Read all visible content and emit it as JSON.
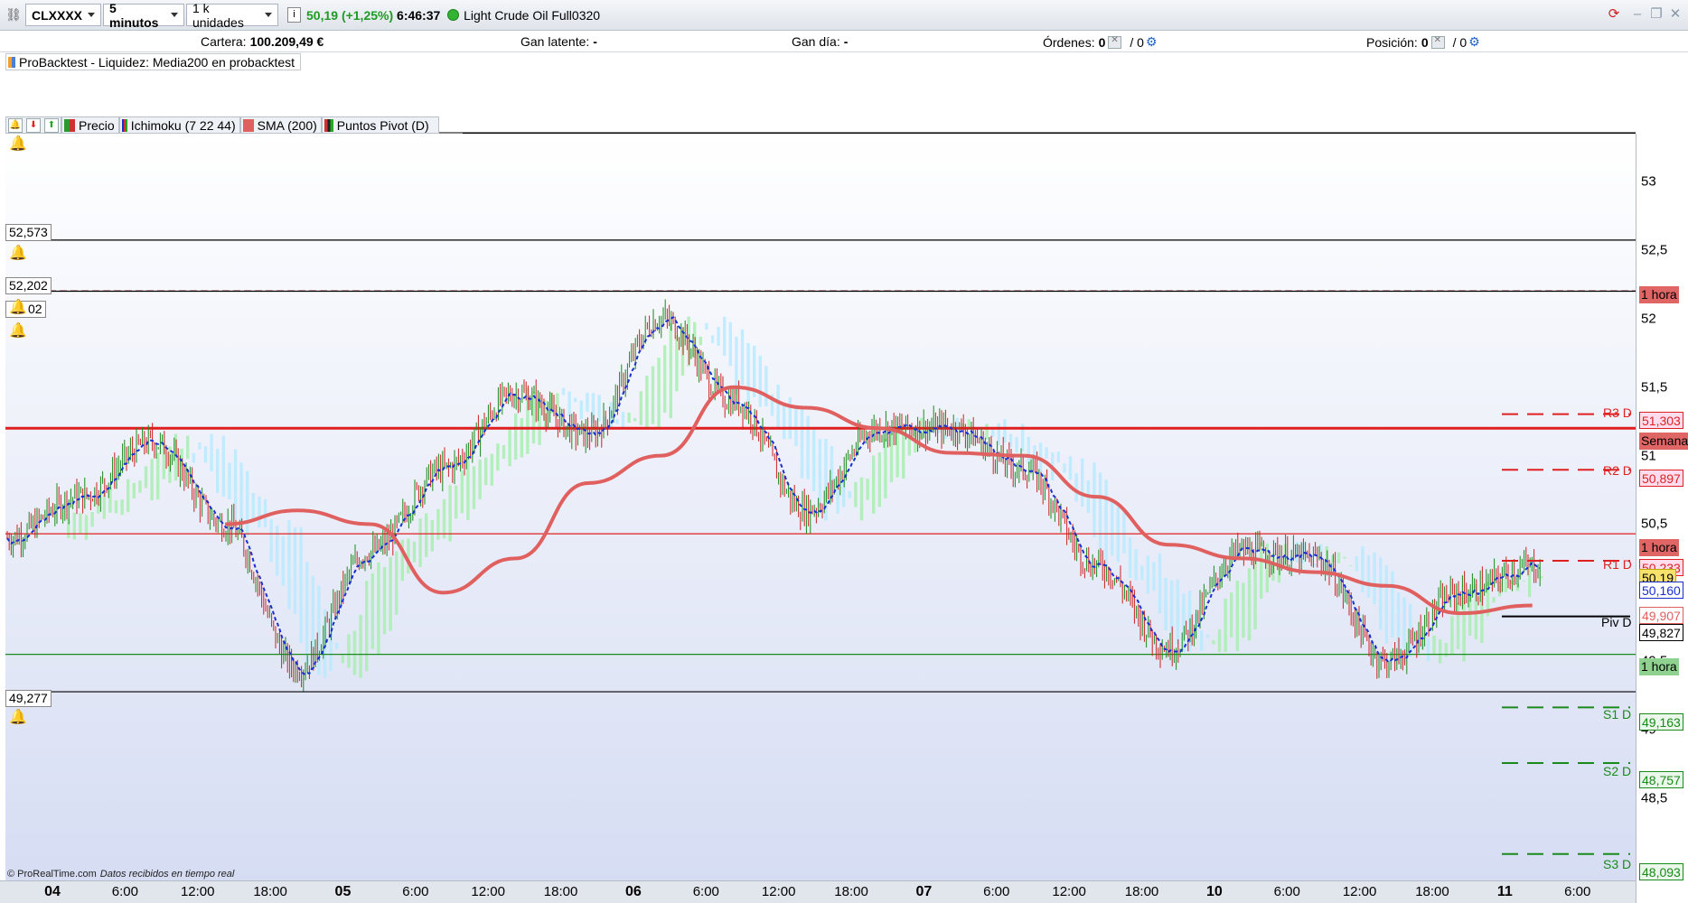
{
  "toolbar": {
    "symbol": "CLXXXX",
    "timeframe": "5 minutos",
    "units": "1 k unidades",
    "price": "50,19",
    "change": "(+1,25%)",
    "time": "6:46:37",
    "instrument": "Light Crude Oil Full0320"
  },
  "account": {
    "cartera_label": "Cartera:",
    "cartera_value": "100.209,49 €",
    "gan_latente_label": "Gan latente:",
    "gan_latente_value": "-",
    "gan_dia_label": "Gan día:",
    "gan_dia_value": "-",
    "ordenes_label": "Órdenes:",
    "ordenes_value": "0",
    "ordenes_value2": "/ 0",
    "posicion_label": "Posición:",
    "posicion_value": "0",
    "posicion_value2": "/ 0"
  },
  "probacktest": {
    "label": "ProBacktest - Liquidez: Media200 en probacktest"
  },
  "legend": {
    "items": [
      "Precio",
      "Ichimoku (7 22 44)",
      "SMA (200)",
      "Puntos Pivot (D)"
    ]
  },
  "levels": {
    "a": "52,573",
    "b": "52,202",
    "b_partial": "02",
    "c": "49,277"
  },
  "pivots": {
    "r3": "R3 D",
    "r2": "R2 D",
    "r1": "R1 D",
    "piv": "Piv D",
    "s1": "S1 D",
    "s2": "S2 D",
    "s3": "S3 D"
  },
  "axis_labels": {
    "hora_top": "1 hora",
    "r3": "51,303",
    "semanal": "Semanal",
    "r2": "50,897",
    "hora_mid": "1 hora",
    "r1": "50,233",
    "price": "50,19",
    "ichi": "50,160",
    "sma": "49,907",
    "piv": "49,827",
    "hora_low": "1 hora",
    "s1": "49,163",
    "s2": "48,757",
    "s3": "48,093"
  },
  "footer": {
    "brand": "© ProRealTime.com",
    "status": "Datos recibidos en tiempo real"
  },
  "colors": {
    "up": "#1a8a1a",
    "down": "#cc2222",
    "sma": "#e06060",
    "tenkan": "#1a2fd0",
    "kumo_bull": "#a8eeb0",
    "kumo_bear": "#b8eaff",
    "resistance": "#e02020",
    "support": "#1a8a1a",
    "toolbar_price": "#1f9a24"
  },
  "chart_data": {
    "type": "line",
    "instrument": "Light Crude Oil Full0320",
    "ylim": [
      47.9,
      53.35
    ],
    "y_ticks": [
      "53",
      "52,5",
      "52",
      "51,5",
      "51",
      "50,5",
      "50",
      "49,5",
      "49",
      "48,5"
    ],
    "x_ticks": [
      "04",
      "6:00",
      "12:00",
      "18:00",
      "05",
      "6:00",
      "12:00",
      "18:00",
      "06",
      "6:00",
      "12:00",
      "18:00",
      "07",
      "6:00",
      "12:00",
      "18:00",
      "10",
      "6:00",
      "12:00",
      "18:00",
      "11",
      "6:00"
    ],
    "x_bold": [
      "04",
      "05",
      "06",
      "07",
      "10",
      "11"
    ],
    "series": [
      {
        "name": "Precio",
        "type": "candlestick",
        "x": [
          "04 00:00",
          "04 06:00",
          "04 12:00",
          "04 18:00",
          "05 00:00",
          "05 06:00",
          "05 12:00",
          "05 18:00",
          "06 00:00",
          "06 06:00",
          "06 12:00",
          "06 18:00",
          "07 00:00",
          "07 06:00",
          "07 12:00",
          "07 18:00",
          "10 00:00",
          "10 06:00",
          "10 12:00",
          "10 18:00",
          "11 00:00",
          "11 06:00"
        ],
        "values": [
          50.4,
          50.7,
          51.1,
          50.5,
          49.45,
          50.3,
          50.9,
          51.45,
          51.15,
          52.0,
          51.4,
          50.6,
          51.2,
          51.2,
          50.9,
          50.2,
          49.6,
          50.3,
          50.25,
          49.5,
          50.0,
          50.19
        ]
      },
      {
        "name": "SMA (200)",
        "x": [
          "04 18:00",
          "05 00:00",
          "05 06:00",
          "05 12:00",
          "05 18:00",
          "06 00:00",
          "06 06:00",
          "06 12:00",
          "06 18:00",
          "07 00:00",
          "07 06:00",
          "07 12:00",
          "07 18:00",
          "10 00:00",
          "10 06:00",
          "10 12:00",
          "10 18:00",
          "11 00:00",
          "11 06:00"
        ],
        "values": [
          50.5,
          50.6,
          50.5,
          50.0,
          50.25,
          50.8,
          51.0,
          51.5,
          51.35,
          51.2,
          51.02,
          51.0,
          50.7,
          50.35,
          50.25,
          50.15,
          50.05,
          49.85,
          49.907
        ]
      },
      {
        "name": "Tenkan",
        "values_ref": "Precio"
      }
    ],
    "hlines": [
      {
        "value": 52.573,
        "color": "#000000",
        "style": "solid"
      },
      {
        "value": 52.202,
        "color": "#000000",
        "style": "dashed"
      },
      {
        "value": 52.2,
        "color": "#000000",
        "style": "solid"
      },
      {
        "value": 51.2,
        "color": "#e02020",
        "style": "solid",
        "label": "Semanal"
      },
      {
        "value": 50.43,
        "color": "#e02020",
        "style": "solid",
        "label": "1 hora"
      },
      {
        "value": 49.55,
        "color": "#1a8a1a",
        "style": "solid",
        "label": "1 hora"
      },
      {
        "value": 49.277,
        "color": "#000000",
        "style": "solid"
      }
    ],
    "pivots": [
      {
        "name": "R3 D",
        "value": 51.303
      },
      {
        "name": "R2 D",
        "value": 50.897
      },
      {
        "name": "R1 D",
        "value": 50.233
      },
      {
        "name": "Piv D",
        "value": 49.827
      },
      {
        "name": "S1 D",
        "value": 49.163
      },
      {
        "name": "S2 D",
        "value": 48.757
      },
      {
        "name": "S3 D",
        "value": 48.093
      }
    ]
  }
}
